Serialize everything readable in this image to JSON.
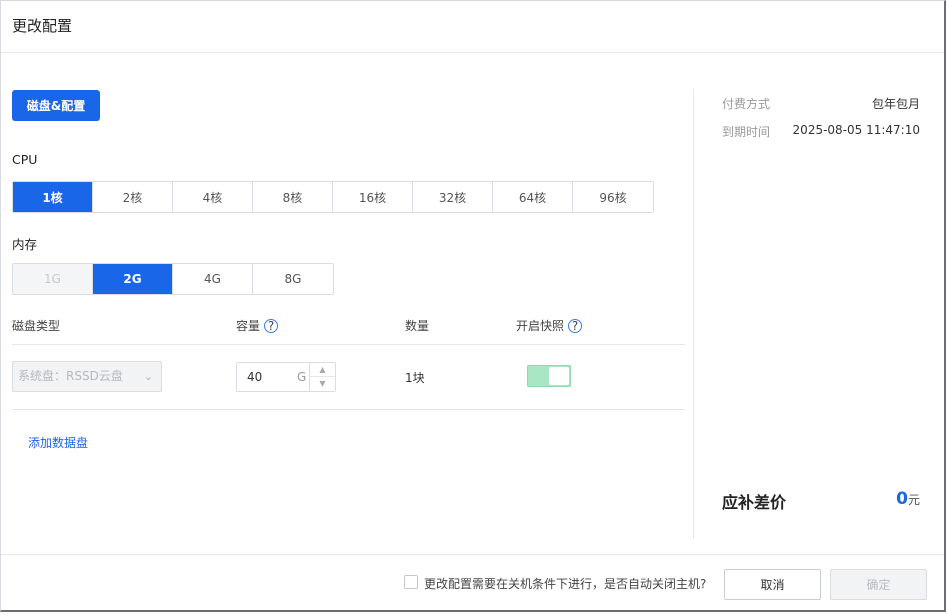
{
  "header": {
    "title": "更改配置"
  },
  "tab": {
    "label": "磁盘&配置"
  },
  "cpu": {
    "label": "CPU",
    "options": [
      "1核",
      "2核",
      "4核",
      "8核",
      "16核",
      "32核",
      "64核",
      "96核"
    ],
    "selected": "1核"
  },
  "memory": {
    "label": "内存",
    "options": [
      "1G",
      "2G",
      "4G",
      "8G"
    ],
    "selected": "2G",
    "disabled": [
      "1G"
    ]
  },
  "disk_table": {
    "headers": {
      "type": "磁盘类型",
      "capacity": "容量",
      "count": "数量",
      "snapshot": "开启快照"
    },
    "help_glyph": "?",
    "row": {
      "type": "系统盘：RSSD云盘",
      "capacity_value": "40",
      "capacity_unit": "G",
      "count": "1块",
      "snapshot_enabled": true
    },
    "add_link": "添加数据盘"
  },
  "summary": {
    "pay_label": "付费方式",
    "pay_value": "包年包月",
    "expire_label": "到期时间",
    "expire_value": "2025-08-05 11:47:10",
    "diff_label": "应补差价",
    "diff_amount": "0",
    "diff_unit": "元"
  },
  "footer": {
    "shutdown_checkbox_label": "更改配置需要在关机条件下进行，是否自动关闭主机?",
    "cancel_label": "取消",
    "ok_label": "确定"
  },
  "colors": {
    "accent": "#1a66e8",
    "toggle_on": "#a8e6c4"
  },
  "icons": {
    "dropdown": "chevron-down-icon",
    "help": "help-circle-icon",
    "stepper_up": "chevron-up-icon",
    "stepper_down": "chevron-down-icon"
  }
}
